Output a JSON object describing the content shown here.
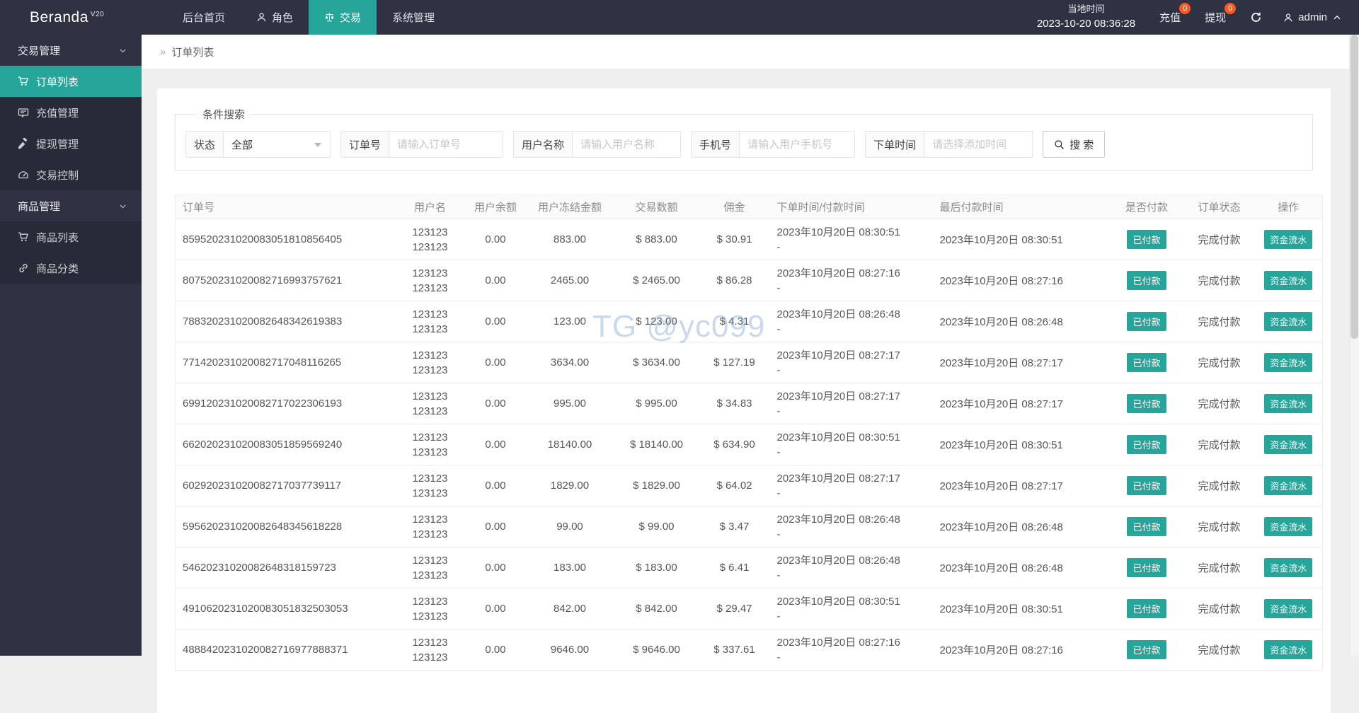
{
  "colors": {
    "accent": "#26a69a",
    "badge": "#ff5722",
    "topbar_bg": "#2e3242",
    "watermark": "#7da5d7"
  },
  "topbar": {
    "logo": "Beranda",
    "logo_sup": "V20",
    "nav": [
      {
        "label": "后台首页"
      },
      {
        "label": "角色"
      },
      {
        "label": "交易"
      },
      {
        "label": "系统管理"
      }
    ],
    "time_label": "当地时间",
    "time_value": "2023-10-20 08:36:28",
    "recharge_label": "充值",
    "recharge_badge": "0",
    "withdraw_label": "提现",
    "withdraw_badge": "0",
    "admin_label": "admin"
  },
  "sidebar": {
    "groups": [
      {
        "label": "交易管理",
        "items": [
          {
            "label": "订单列表"
          },
          {
            "label": "充值管理"
          },
          {
            "label": "提现管理"
          },
          {
            "label": "交易控制"
          }
        ]
      },
      {
        "label": "商品管理",
        "items": [
          {
            "label": "商品列表"
          },
          {
            "label": "商品分类"
          }
        ]
      }
    ]
  },
  "breadcrumb": {
    "icon": "»",
    "label": "订单列表"
  },
  "search": {
    "legend": "条件搜索",
    "status_label": "状态",
    "status_value": "全部",
    "order_label": "订单号",
    "order_placeholder": "请输入订单号",
    "username_label": "用户名称",
    "username_placeholder": "请输入用户名称",
    "phone_label": "手机号",
    "phone_placeholder": "请输入用户手机号",
    "time_label": "下单时间",
    "time_placeholder": "请选择添加时间",
    "search_button": "搜 索"
  },
  "watermark": "TG @yc099",
  "table": {
    "headers": [
      "订单号",
      "用户名",
      "用户余额",
      "用户冻结金额",
      "交易数额",
      "佣金",
      "下单时间/付款时间",
      "最后付款时间",
      "是否付款",
      "订单状态",
      "操作"
    ],
    "rows": [
      {
        "order_no": "859520231020083051810856405",
        "username": [
          "123123",
          "123123"
        ],
        "balance": "0.00",
        "frozen": "883.00",
        "amount": "$ 883.00",
        "commission": "$ 30.91",
        "order_time": "2023年10月20日 08:30:51",
        "pay_time": "-",
        "last_pay_time": "2023年10月20日 08:30:51",
        "paid": "已付款",
        "status": "完成付款",
        "action": "资金流水"
      },
      {
        "order_no": "807520231020082716993757621",
        "username": [
          "123123",
          "123123"
        ],
        "balance": "0.00",
        "frozen": "2465.00",
        "amount": "$ 2465.00",
        "commission": "$ 86.28",
        "order_time": "2023年10月20日 08:27:16",
        "pay_time": "-",
        "last_pay_time": "2023年10月20日 08:27:16",
        "paid": "已付款",
        "status": "完成付款",
        "action": "资金流水"
      },
      {
        "order_no": "788320231020082648342619383",
        "username": [
          "123123",
          "123123"
        ],
        "balance": "0.00",
        "frozen": "123.00",
        "amount": "$ 123.00",
        "commission": "$ 4.31",
        "order_time": "2023年10月20日 08:26:48",
        "pay_time": "-",
        "last_pay_time": "2023年10月20日 08:26:48",
        "paid": "已付款",
        "status": "完成付款",
        "action": "资金流水"
      },
      {
        "order_no": "771420231020082717048116265",
        "username": [
          "123123",
          "123123"
        ],
        "balance": "0.00",
        "frozen": "3634.00",
        "amount": "$ 3634.00",
        "commission": "$ 127.19",
        "order_time": "2023年10月20日 08:27:17",
        "pay_time": "-",
        "last_pay_time": "2023年10月20日 08:27:17",
        "paid": "已付款",
        "status": "完成付款",
        "action": "资金流水"
      },
      {
        "order_no": "699120231020082717022306193",
        "username": [
          "123123",
          "123123"
        ],
        "balance": "0.00",
        "frozen": "995.00",
        "amount": "$ 995.00",
        "commission": "$ 34.83",
        "order_time": "2023年10月20日 08:27:17",
        "pay_time": "-",
        "last_pay_time": "2023年10月20日 08:27:17",
        "paid": "已付款",
        "status": "完成付款",
        "action": "资金流水"
      },
      {
        "order_no": "662020231020083051859569240",
        "username": [
          "123123",
          "123123"
        ],
        "balance": "0.00",
        "frozen": "18140.00",
        "amount": "$ 18140.00",
        "commission": "$ 634.90",
        "order_time": "2023年10月20日 08:30:51",
        "pay_time": "-",
        "last_pay_time": "2023年10月20日 08:30:51",
        "paid": "已付款",
        "status": "完成付款",
        "action": "资金流水"
      },
      {
        "order_no": "602920231020082717037739117",
        "username": [
          "123123",
          "123123"
        ],
        "balance": "0.00",
        "frozen": "1829.00",
        "amount": "$ 1829.00",
        "commission": "$ 64.02",
        "order_time": "2023年10月20日 08:27:17",
        "pay_time": "-",
        "last_pay_time": "2023年10月20日 08:27:17",
        "paid": "已付款",
        "status": "完成付款",
        "action": "资金流水"
      },
      {
        "order_no": "595620231020082648345618228",
        "username": [
          "123123",
          "123123"
        ],
        "balance": "0.00",
        "frozen": "99.00",
        "amount": "$ 99.00",
        "commission": "$ 3.47",
        "order_time": "2023年10月20日 08:26:48",
        "pay_time": "-",
        "last_pay_time": "2023年10月20日 08:26:48",
        "paid": "已付款",
        "status": "完成付款",
        "action": "资金流水"
      },
      {
        "order_no": "54620231020082648318159723",
        "username": [
          "123123",
          "123123"
        ],
        "balance": "0.00",
        "frozen": "183.00",
        "amount": "$ 183.00",
        "commission": "$ 6.41",
        "order_time": "2023年10月20日 08:26:48",
        "pay_time": "-",
        "last_pay_time": "2023年10月20日 08:26:48",
        "paid": "已付款",
        "status": "完成付款",
        "action": "资金流水"
      },
      {
        "order_no": "4910620231020083051832503053",
        "username": [
          "123123",
          "123123"
        ],
        "balance": "0.00",
        "frozen": "842.00",
        "amount": "$ 842.00",
        "commission": "$ 29.47",
        "order_time": "2023年10月20日 08:30:51",
        "pay_time": "-",
        "last_pay_time": "2023年10月20日 08:30:51",
        "paid": "已付款",
        "status": "完成付款",
        "action": "资金流水"
      },
      {
        "order_no": "4888420231020082716977888371",
        "username": [
          "123123",
          "123123"
        ],
        "balance": "0.00",
        "frozen": "9646.00",
        "amount": "$ 9646.00",
        "commission": "$ 337.61",
        "order_time": "2023年10月20日 08:27:16",
        "pay_time": "-",
        "last_pay_time": "2023年10月20日 08:27:16",
        "paid": "已付款",
        "status": "完成付款",
        "action": "资金流水"
      }
    ]
  }
}
